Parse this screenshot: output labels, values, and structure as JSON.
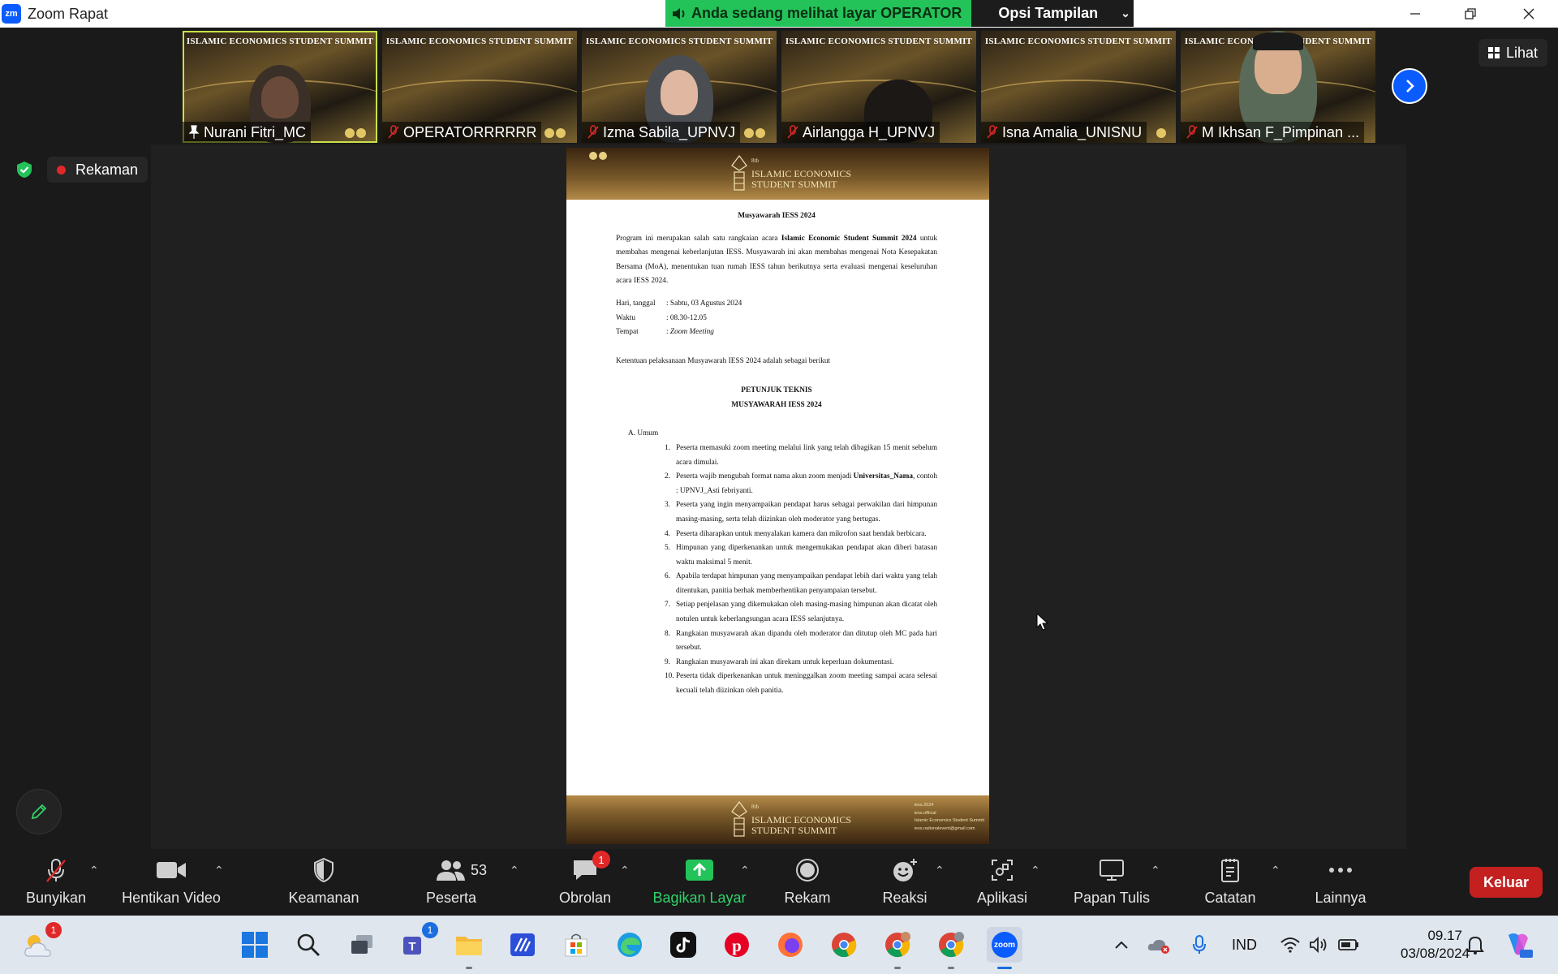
{
  "window": {
    "title": "Zoom Rapat",
    "logo": "zm"
  },
  "share_banner": {
    "viewing_text": "Anda sedang melihat layar OPERATOR",
    "options_label": "Opsi Tampilan"
  },
  "gallery": {
    "banner_text": "ISLAMIC ECONOMICS STUDENT SUMMIT",
    "participants": [
      {
        "name": "Nurani Fitri_MC"
      },
      {
        "name": "OPERATORRRRRR"
      },
      {
        "name": "Izma Sabila_UPNVJ"
      },
      {
        "name": "Airlangga H_UPNVJ"
      },
      {
        "name": "Isna Amalia_UNISNU"
      },
      {
        "name": "M Ikhsan F_Pimpinan ..."
      }
    ]
  },
  "view_button": "Lihat",
  "recording_label": "Rekaman",
  "document": {
    "header_brand": {
      "edition": "8th",
      "line1": "ISLAMIC ECONOMICS",
      "line2": "STUDENT SUMMIT"
    },
    "title": "Musyawarah IESS 2024",
    "intro_pre": "Program ini merupakan salah satu rangkaian acara ",
    "intro_bold": "Islamic Economic Student Summit 2024",
    "intro_post": " untuk membahas mengenai keberlanjutan IESS. Musyawarah ini akan membahas mengenai Nota Kesepakatan Bersama (MoA), menentukan tuan rumah IESS tahun berikutnya serta evaluasi mengenai keseluruhan acara IESS 2024.",
    "info": [
      {
        "key": "Hari, tanggal",
        "value": ": Sabtu, 03 Agustus 2024"
      },
      {
        "key": "Waktu",
        "value": ": 08.30-12.05"
      },
      {
        "key": "Tempat",
        "value": ": ",
        "value_italic": "Zoom Meeting"
      }
    ],
    "rules_intro": "Ketentuan pelaksanaan Musyawarah IESS 2024 adalah sebagai berikut",
    "juknis_line1": "PETUNJUK TEKNIS",
    "juknis_line2": "MUSYAWARAH IESS 2024",
    "section_label": "A.  Umum",
    "rules": [
      {
        "n": "1.",
        "text": "Peserta memasuki zoom meeting melalui link yang telah dibagikan 15 menit sebelum acara dimulai."
      },
      {
        "n": "2.",
        "pre": "Peserta wajib mengubah format nama akun zoom menjadi ",
        "bold": "Universitas_Nama",
        "post": ", contoh : UPNVJ_Asti febriyanti."
      },
      {
        "n": "3.",
        "text": "Peserta yang ingin menyampaikan pendapat harus sebagai perwakilan dari himpunan masing-masing, serta telah diizinkan oleh moderator yang bertugas."
      },
      {
        "n": "4.",
        "text": "Peserta diharapkan untuk menyalakan kamera dan mikrofon saat hendak berbicara."
      },
      {
        "n": "5.",
        "text": "Himpunan yang diperkenankan untuk mengemukakan pendapat akan diberi batasan waktu maksimal 5 menit."
      },
      {
        "n": "6.",
        "text": "Apabila terdapat himpunan yang menyampaikan pendapat lebih dari waktu yang telah ditentukan, panitia berhak memberhentikan penyampaian tersebut."
      },
      {
        "n": "7.",
        "text": "Setiap penjelasan yang dikemukakan oleh masing-masing himpunan akan dicatat oleh notulen untuk keberlangsungan acara IESS selanjutnya."
      },
      {
        "n": "8.",
        "text": "Rangkaian musyawarah akan dipandu oleh moderator dan ditutup oleh MC pada hari tersebut."
      },
      {
        "n": "9.",
        "text": "Rangkaian musyawarah ini akan direkam untuk keperluan dokumentasi."
      },
      {
        "n": "10.",
        "text": "Peserta tidak diperkenankan untuk meninggalkan zoom meeting sampai acara selesai kecuali telah diizinkan oleh panitia."
      }
    ],
    "footer_social": [
      "iess.2024",
      "iess.official",
      "Islamic Economics Student Summit",
      "iess.nationalevent@gmail.com"
    ]
  },
  "toolbar": {
    "unmute": "Bunyikan",
    "stop_video": "Hentikan Video",
    "security": "Keamanan",
    "participants": "Peserta",
    "participants_count": "53",
    "chat": "Obrolan",
    "chat_badge": "1",
    "share_screen": "Bagikan Layar",
    "record": "Rekam",
    "reactions": "Reaksi",
    "apps": "Aplikasi",
    "whiteboard": "Papan Tulis",
    "notes": "Catatan",
    "more": "Lainnya",
    "leave": "Keluar"
  },
  "taskbar": {
    "weather_badge": "1",
    "teams_badge": "1",
    "zoom_label": "zoom",
    "language": "IND",
    "time": "09.17",
    "date": "03/08/2024"
  },
  "colors": {
    "accent": "#0b5cff",
    "share_green": "#23c35a",
    "leave_red": "#c42020",
    "gold": "#c8a050"
  }
}
